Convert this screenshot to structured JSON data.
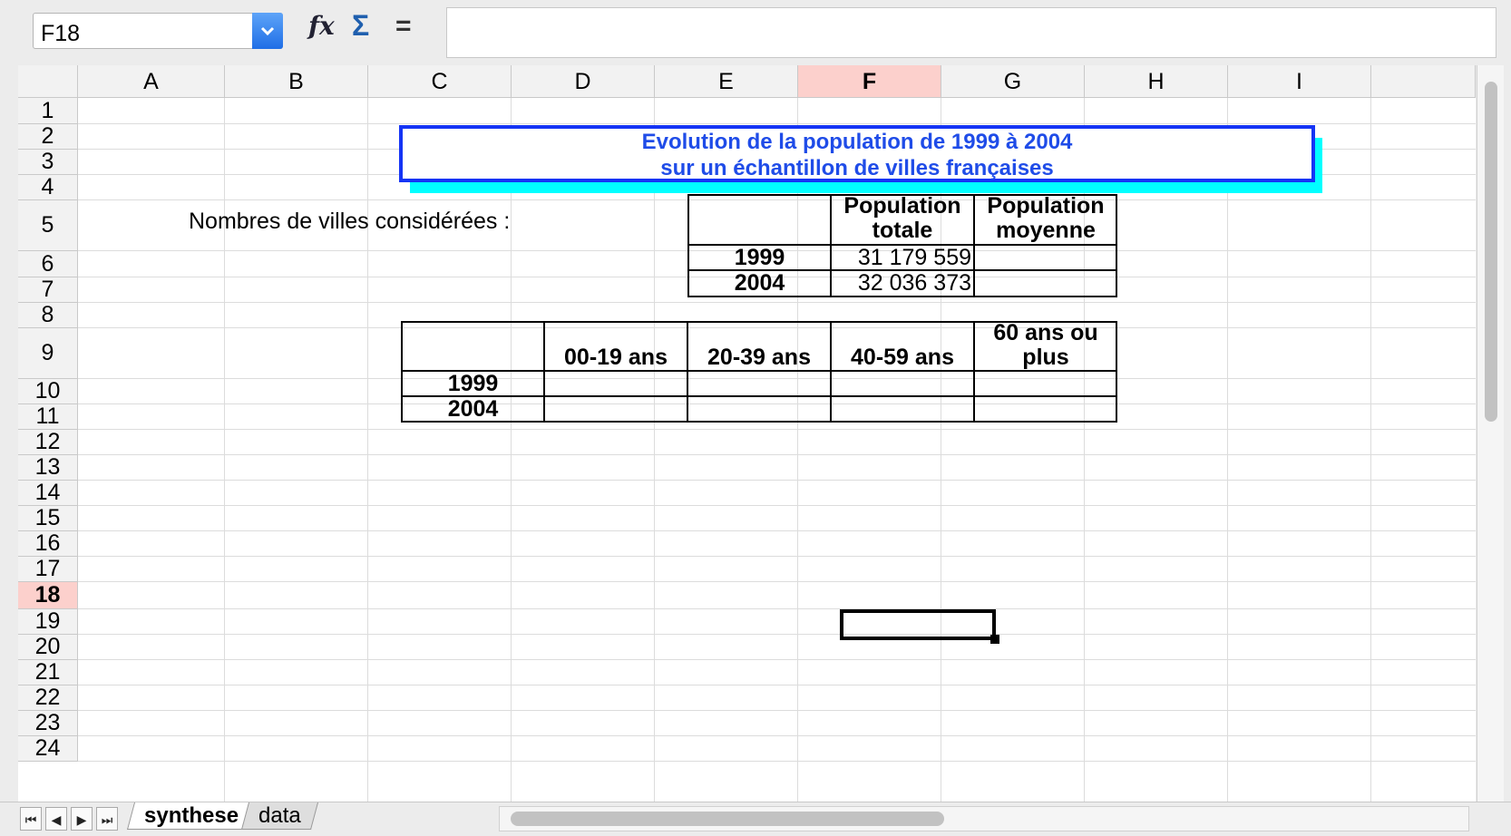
{
  "formula_bar": {
    "cell_reference": "F18",
    "formula_value": ""
  },
  "columns": [
    "A",
    "B",
    "C",
    "D",
    "E",
    "F",
    "G",
    "H",
    "I"
  ],
  "selected_column": "F",
  "rows": [
    "1",
    "2",
    "3",
    "4",
    "5",
    "6",
    "7",
    "8",
    "9",
    "10",
    "11",
    "12",
    "13",
    "14",
    "15",
    "16",
    "17",
    "18",
    "19",
    "20",
    "21",
    "22",
    "23",
    "24"
  ],
  "selected_row": "18",
  "title": {
    "line1": "Evolution de la population de 1999 à 2004",
    "line2": "sur un échantillon de villes françaises"
  },
  "cities_label": "Nombres de villes considérées :",
  "table1": {
    "headers": [
      "Population totale",
      "Population moyenne"
    ],
    "header_lines": [
      [
        "Population",
        "totale"
      ],
      [
        "Population",
        "moyenne"
      ]
    ],
    "rows": [
      {
        "year": "1999",
        "total": "31 179 559",
        "avg": ""
      },
      {
        "year": "2004",
        "total": "32 036 373",
        "avg": ""
      }
    ]
  },
  "table2": {
    "headers": [
      "00-19 ans",
      "20-39 ans",
      "40-59 ans",
      "60 ans ou plus"
    ],
    "header_last_lines": [
      "60 ans ou",
      "plus"
    ],
    "rows": [
      {
        "year": "1999"
      },
      {
        "year": "2004"
      }
    ]
  },
  "sheet_tabs": [
    "synthese",
    "data"
  ],
  "active_sheet": "synthese",
  "colors": {
    "title_text": "#1f4ce8",
    "title_border": "#1534f5",
    "title_shadow": "#00ffff",
    "selection_header": "#fcd0cc"
  }
}
